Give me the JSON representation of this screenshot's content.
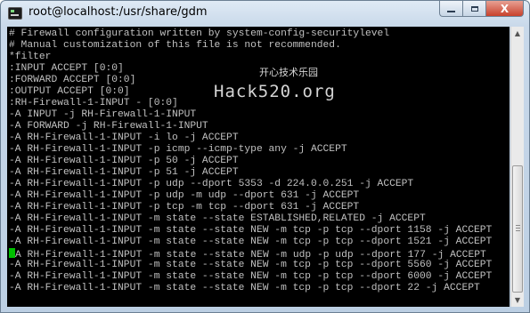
{
  "window": {
    "title": "root@localhost:/usr/share/gdm",
    "buttons": {
      "minimize_label": "",
      "maximize_label": "",
      "close_label": "X"
    }
  },
  "terminal": {
    "lines": [
      "# Firewall configuration written by system-config-securitylevel",
      "# Manual customization of this file is not recommended.",
      "*filter",
      ":INPUT ACCEPT [0:0]",
      ":FORWARD ACCEPT [0:0]",
      ":OUTPUT ACCEPT [0:0]",
      ":RH-Firewall-1-INPUT - [0:0]",
      "-A INPUT -j RH-Firewall-1-INPUT",
      "-A FORWARD -j RH-Firewall-1-INPUT",
      "-A RH-Firewall-1-INPUT -i lo -j ACCEPT",
      "-A RH-Firewall-1-INPUT -p icmp --icmp-type any -j ACCEPT",
      "-A RH-Firewall-1-INPUT -p 50 -j ACCEPT",
      "-A RH-Firewall-1-INPUT -p 51 -j ACCEPT",
      "-A RH-Firewall-1-INPUT -p udp --dport 5353 -d 224.0.0.251 -j ACCEPT",
      "-A RH-Firewall-1-INPUT -p udp -m udp --dport 631 -j ACCEPT",
      "-A RH-Firewall-1-INPUT -p tcp -m tcp --dport 631 -j ACCEPT",
      "-A RH-Firewall-1-INPUT -m state --state ESTABLISHED,RELATED -j ACCEPT",
      "-A RH-Firewall-1-INPUT -m state --state NEW -m tcp -p tcp --dport 1158 -j ACCEPT",
      "-A RH-Firewall-1-INPUT -m state --state NEW -m tcp -p tcp --dport 1521 -j ACCEPT",
      "A RH-Firewall-1-INPUT -m state --state NEW -m udp -p udp --dport 177 -j ACCEPT",
      "-A RH-Firewall-1-INPUT -m state --state NEW -m tcp -p tcp --dport 5560 -j ACCEPT",
      "-A RH-Firewall-1-INPUT -m state --state NEW -m tcp -p tcp --dport 6000 -j ACCEPT",
      "-A RH-Firewall-1-INPUT -m state --state NEW -m tcp -p tcp --dport 22 -j ACCEPT"
    ],
    "cursor_line": 19,
    "colors": {
      "background": "#000000",
      "text": "#c0c0c0",
      "cursor": "#00c000"
    }
  },
  "watermark": {
    "chinese_text": "开心技术乐园",
    "site_text": "Hack520.org"
  },
  "scrollbar": {
    "up_arrow": "▲",
    "down_arrow": "▼"
  }
}
